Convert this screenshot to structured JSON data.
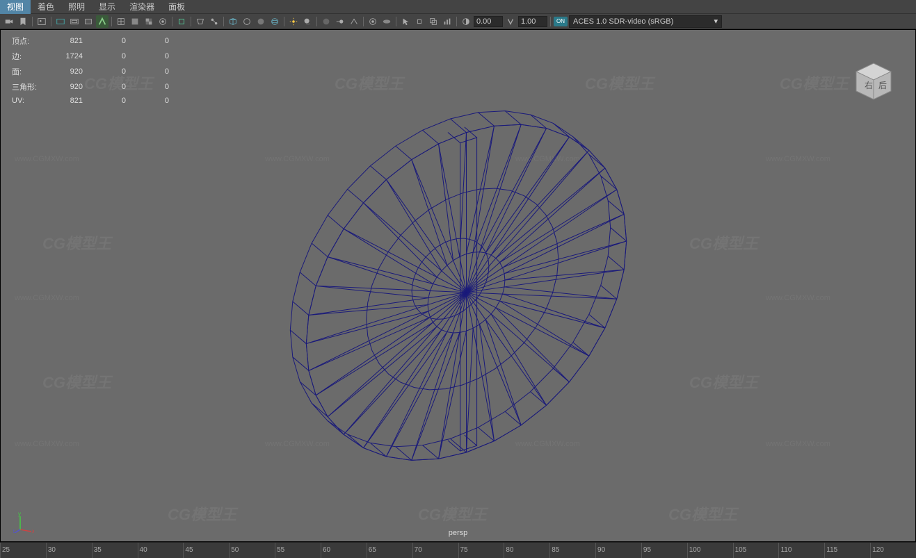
{
  "menubar": {
    "items": [
      "视图",
      "着色",
      "照明",
      "显示",
      "渲染器",
      "面板"
    ],
    "active_index": 0
  },
  "toolbar": {
    "exposure_value": "0.00",
    "gamma_value": "1.00",
    "color_on_badge": "ON",
    "color_space": "ACES 1.0 SDR-video (sRGB)"
  },
  "stats": {
    "rows": [
      {
        "label": "顶点:",
        "a": "821",
        "b": "0",
        "c": "0"
      },
      {
        "label": "边:",
        "a": "1724",
        "b": "0",
        "c": "0"
      },
      {
        "label": "面:",
        "a": "920",
        "b": "0",
        "c": "0"
      },
      {
        "label": "三角形:",
        "a": "920",
        "b": "0",
        "c": "0"
      },
      {
        "label": "UV:",
        "a": "821",
        "b": "0",
        "c": "0"
      }
    ]
  },
  "viewcube": {
    "label1": "右",
    "label2": "后"
  },
  "camera": {
    "name": "persp"
  },
  "axis": {
    "x": "x",
    "y": "y",
    "z": "z"
  },
  "timeline": {
    "ticks": [
      "25",
      "30",
      "35",
      "40",
      "45",
      "50",
      "55",
      "60",
      "65",
      "70",
      "75",
      "80",
      "85",
      "90",
      "95",
      "100",
      "105",
      "110",
      "115",
      "120"
    ]
  },
  "watermark": {
    "text": "CG模型王",
    "url": "www.CGMXW.com"
  }
}
